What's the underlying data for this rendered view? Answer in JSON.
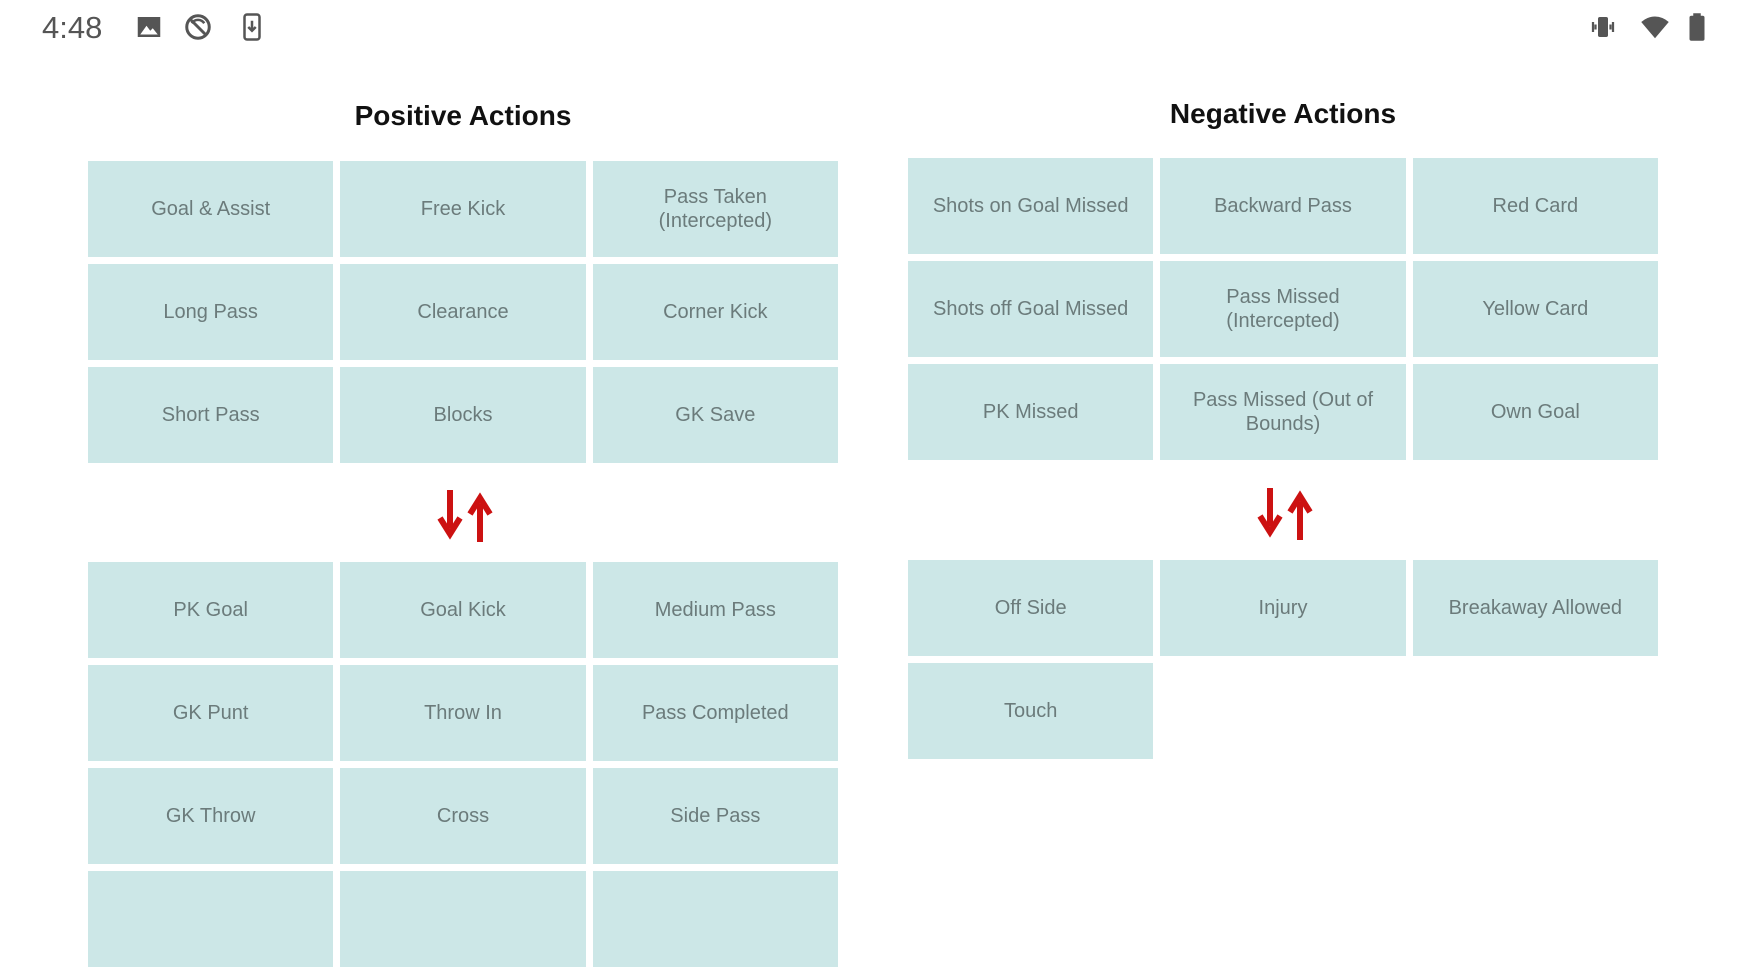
{
  "status_bar": {
    "time": "4:48",
    "left_icons": [
      "image-icon",
      "sync-off-icon",
      "download-icon"
    ],
    "right_icons": [
      "vibrate-icon",
      "wifi-icon",
      "battery-icon"
    ]
  },
  "positive": {
    "title": "Positive Actions",
    "top_grid": [
      "Goal & Assist",
      "Free Kick",
      "Pass Taken (Intercepted)",
      "Long Pass",
      "Clearance",
      "Corner Kick",
      "Short Pass",
      "Blocks",
      "GK Save"
    ],
    "bottom_grid": [
      "PK Goal",
      "Goal Kick",
      "Medium Pass",
      "GK Punt",
      "Throw In",
      "Pass Completed",
      "GK Throw",
      "Cross",
      "Side Pass",
      "",
      "",
      ""
    ]
  },
  "negative": {
    "title": "Negative Actions",
    "top_grid": [
      "Shots on Goal Missed",
      "Backward Pass",
      "Red Card",
      "Shots off Goal Missed",
      "Pass Missed (Intercepted)",
      "Yellow Card",
      "PK Missed",
      "Pass Missed (Out of Bounds)",
      "Own Goal"
    ],
    "bottom_grid": [
      "Off Side",
      "Injury",
      "Breakaway Allowed",
      "Touch"
    ]
  },
  "colors": {
    "tile_bg": "#cce7e7",
    "tile_text": "#6b7b7b",
    "arrow": "#cc1111"
  },
  "icons": {
    "swap": "swap-vertical-icon"
  }
}
